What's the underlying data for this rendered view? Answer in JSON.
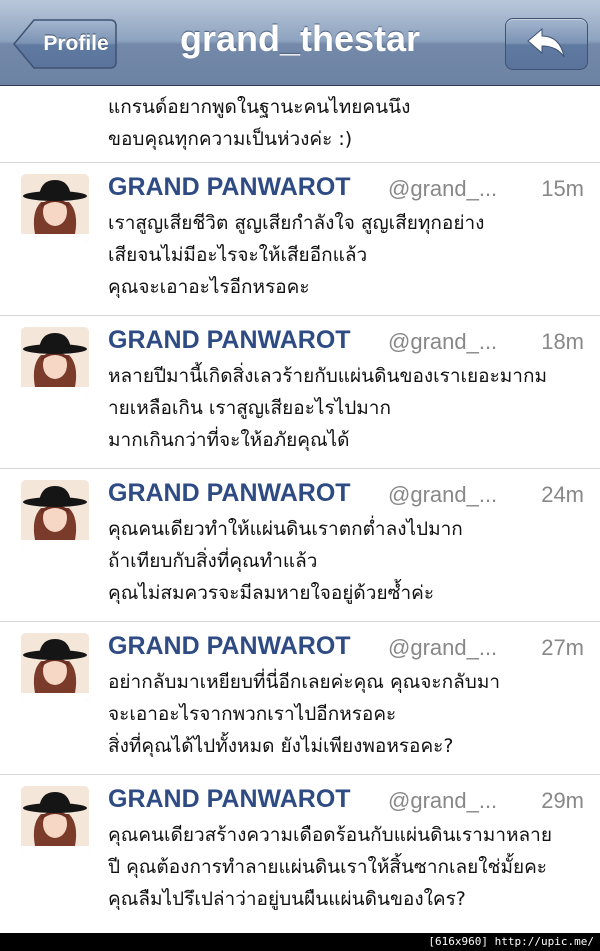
{
  "nav": {
    "title": "grand_thestar",
    "back_label": "Profile",
    "reply_icon": "reply-arrow-icon"
  },
  "partial_tweet": {
    "lines": [
      "แกรนด์อยากพูดในฐานะคนไทยคนนึง",
      "ขอบคุณทุกความเป็นห่วงค่ะ :)"
    ]
  },
  "tweets": [
    {
      "name": "GRAND PANWAROT",
      "handle": "@grand_...",
      "time": "15m",
      "lines": [
        "เราสูญเสียชีวิต สูญเสียกำลังใจ สูญเสียทุกอย่าง",
        "เสียจนไม่มีอะไรจะให้เสียอีกแล้ว",
        "คุณจะเอาอะไรอีกหรอคะ"
      ]
    },
    {
      "name": "GRAND PANWAROT",
      "handle": "@grand_...",
      "time": "18m",
      "lines": [
        "หลายปีมานี้เกิดสิ่งเลวร้ายกับแผ่นดินของเราเยอะมากม",
        "ายเหลือเกิน เราสูญเสียอะไรไปมาก",
        "มากเกินกว่าที่จะให้อภัยคุณได้"
      ]
    },
    {
      "name": "GRAND PANWAROT",
      "handle": "@grand_...",
      "time": "24m",
      "lines": [
        "คุณคนเดียวทำให้แผ่นดินเราตกต่ำลงไปมาก",
        "ถ้าเทียบกับสิ่งที่คุณทำแล้ว",
        "คุณไม่สมควรจะมีลมหายใจอยู่ด้วยซ้ำค่ะ"
      ]
    },
    {
      "name": "GRAND PANWAROT",
      "handle": "@grand_...",
      "time": "27m",
      "lines": [
        "อย่ากลับมาเหยียบที่นี่อีกเลยค่ะคุณ คุณจะกลับมา",
        "จะเอาอะไรจากพวกเราไปอีกหรอคะ",
        "สิ่งที่คุณได้ไปทั้งหมด ยังไม่เพียงพอหรอคะ?"
      ]
    },
    {
      "name": "GRAND PANWAROT",
      "handle": "@grand_...",
      "time": "29m",
      "lines": [
        "คุณคนเดียวสร้างความเดือดร้อนกับแผ่นดินเรามาหลาย",
        "ปี คุณต้องการทำลายแผ่นดินเราให้สิ้นซากเลยใช่มั้ยคะ",
        "คุณลืมไปรึเปล่าว่าอยู่บนผืนแผ่นดินของใคร?"
      ]
    }
  ],
  "watermark": "[616x960] http://upic.me/",
  "colors": {
    "name": "#2f4b84",
    "meta": "#888888",
    "nav_top": "#b9c7d9",
    "nav_bottom": "#6d83a4"
  }
}
